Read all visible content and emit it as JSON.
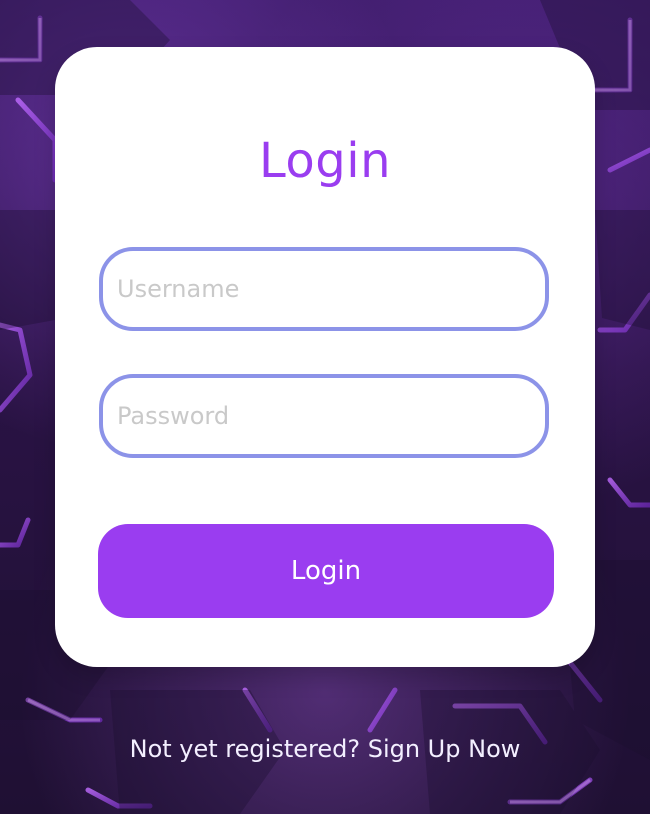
{
  "screen": {
    "title": "Login",
    "username_placeholder": "Username",
    "password_placeholder": "Password",
    "login_button_label": "Login",
    "signup_link_text": "Not yet registered? Sign Up Now"
  },
  "colors": {
    "card_bg": "#ffffff",
    "accent_purple": "#9a3df0",
    "input_border": "#8c93e8",
    "background_dark_purple": "#2a1445",
    "signup_text": "#f3efff"
  }
}
